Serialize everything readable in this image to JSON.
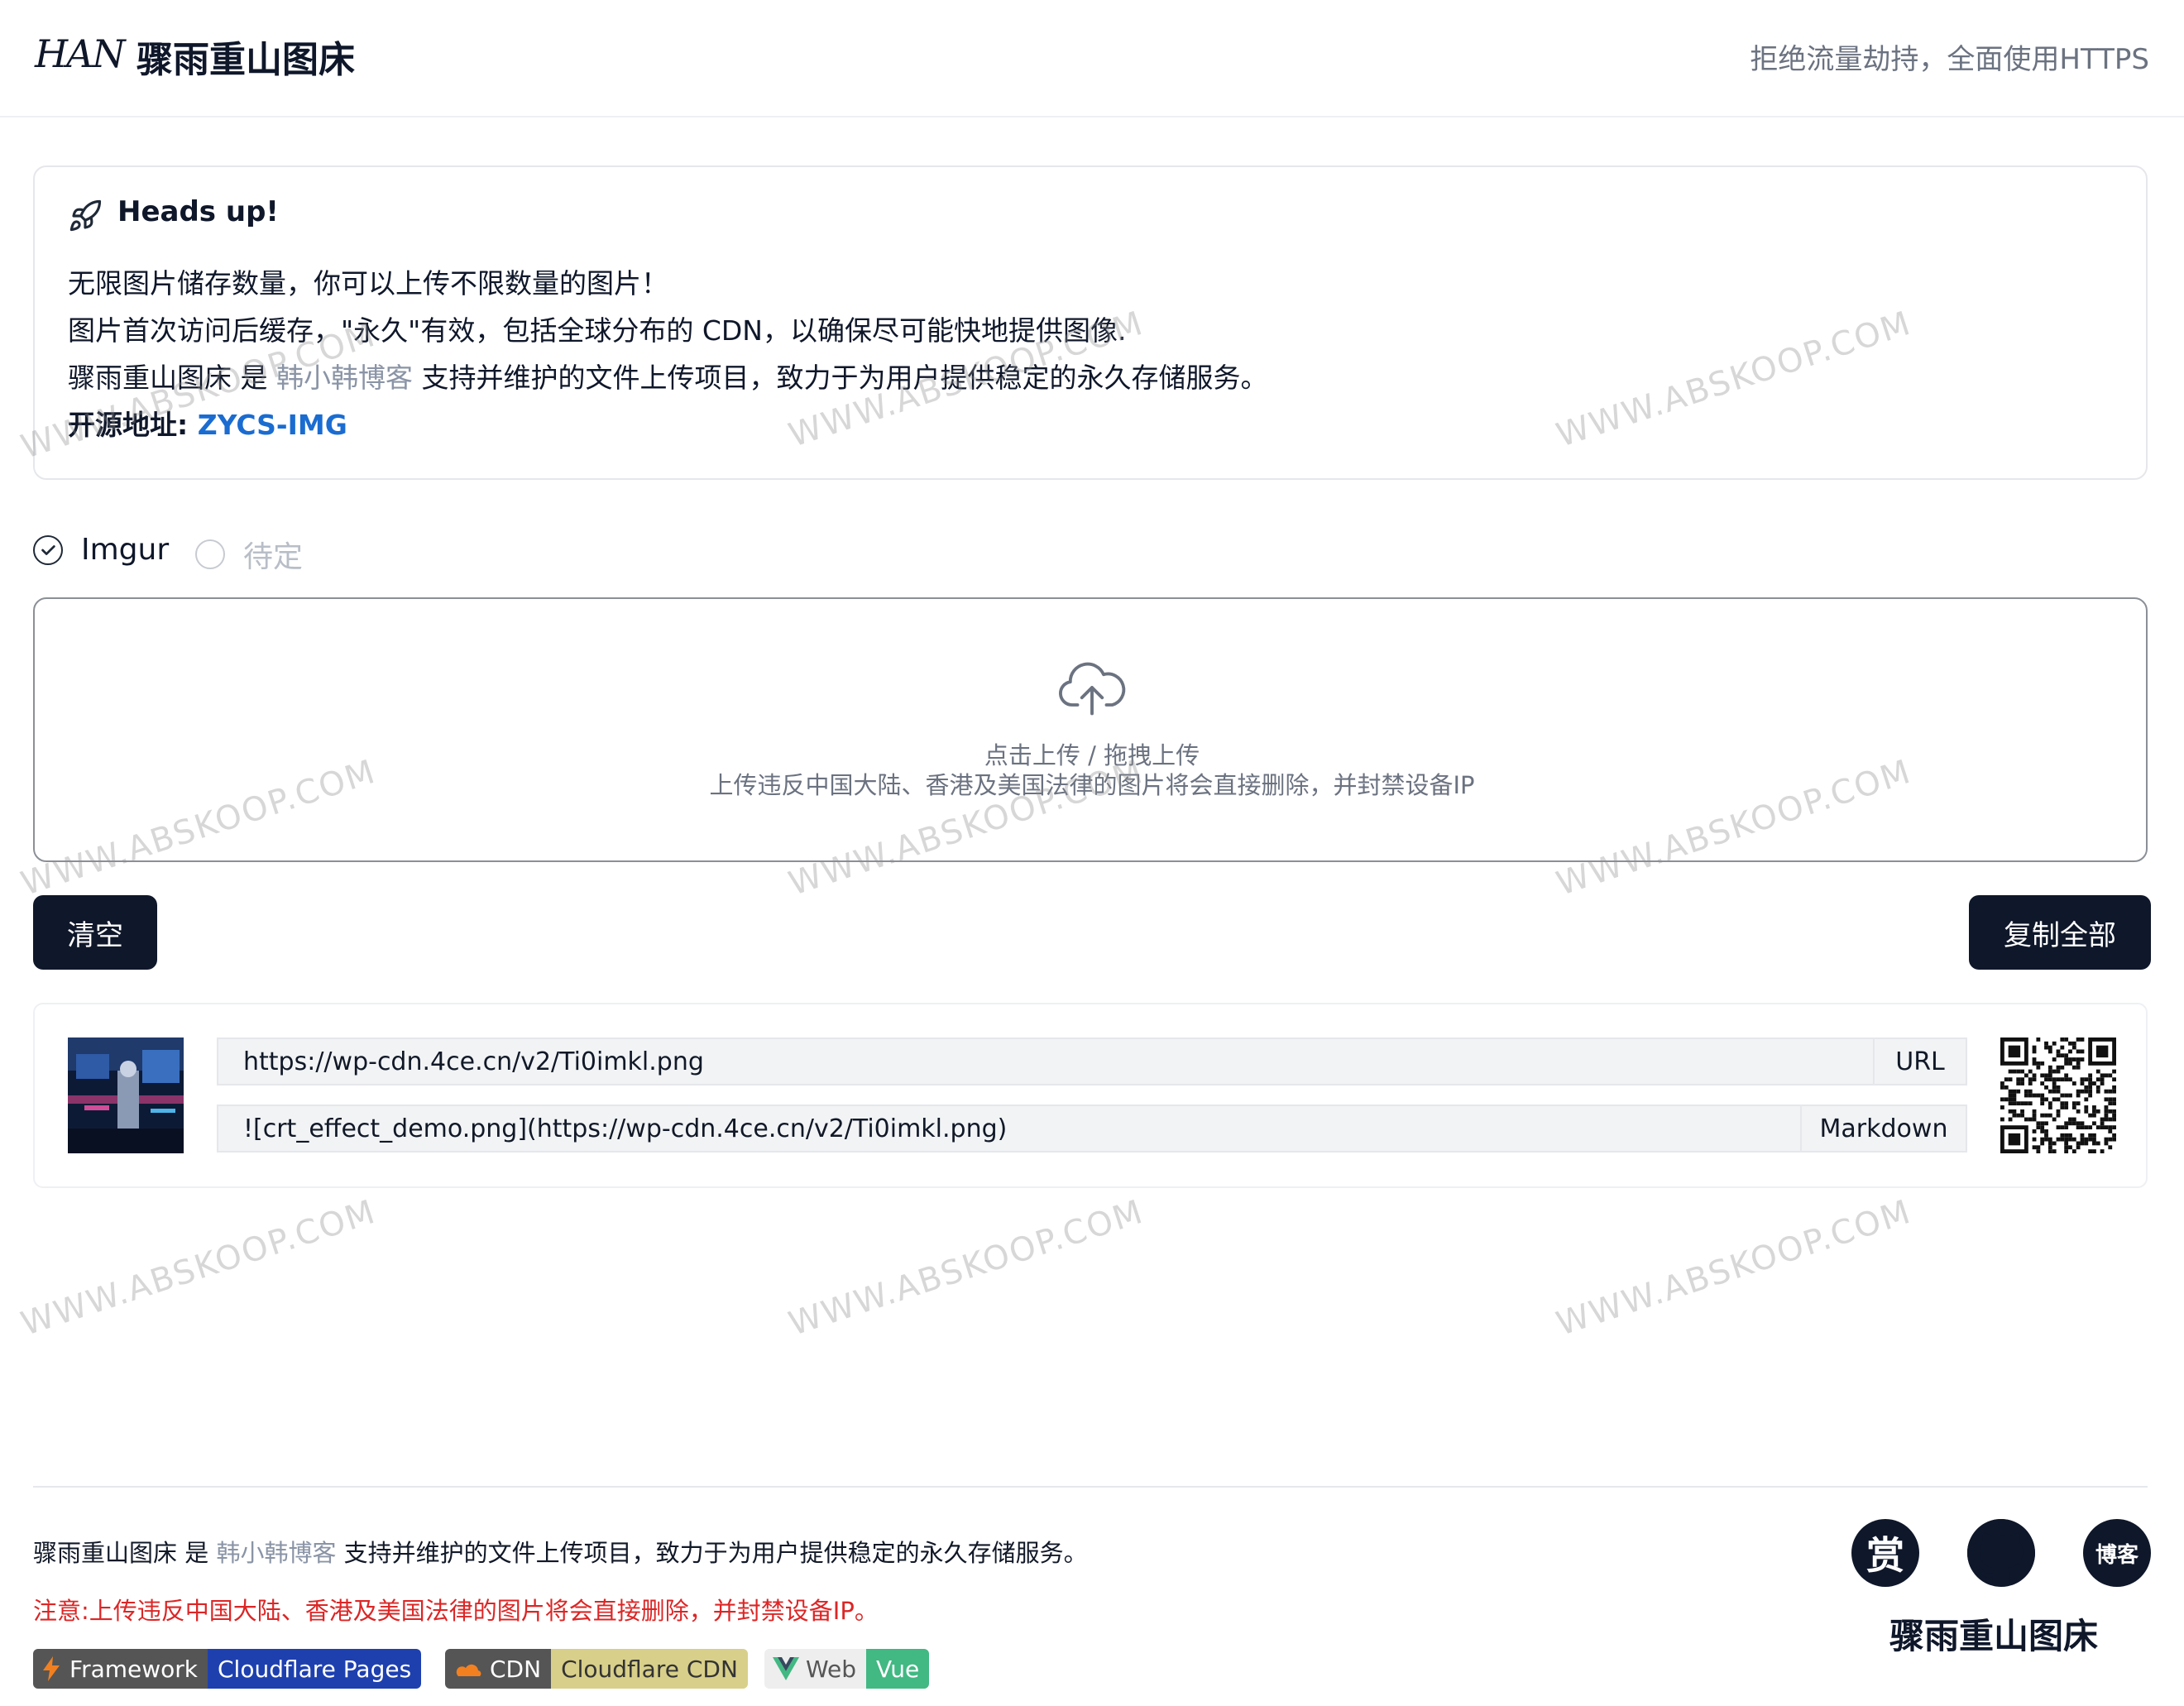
{
  "header": {
    "logo_text": "HAN",
    "title": "骤雨重山图床",
    "tagline": "拒绝流量劫持，全面使用HTTPS"
  },
  "notice": {
    "title": "Heads up!",
    "line1": "无限图片储存数量，你可以上传不限数量的图片！",
    "line2": "图片首次访问后缓存，\"永久\"有效，包括全球分布的 CDN，以确保尽可能快地提供图像.",
    "line3_prefix": "骤雨重山图床 是 ",
    "line3_link": "韩小韩博客",
    "line3_suffix": " 支持并维护的文件上传项目，致力于为用户提供稳定的永久存储服务。",
    "source_label": "开源地址: ",
    "source_link": "ZYCS-IMG"
  },
  "hosts": [
    {
      "label": "Imgur",
      "checked": true
    },
    {
      "label": "待定",
      "checked": false
    }
  ],
  "upload": {
    "primary": "点击上传 / 拖拽上传",
    "warning": "上传违反中国大陆、香港及美国法律的图片将会直接删除，并封禁设备IP"
  },
  "buttons": {
    "clear": "清空",
    "copy_all": "复制全部"
  },
  "result": {
    "url": "https://wp-cdn.4ce.cn/v2/Ti0imkl.png",
    "url_label": "URL",
    "markdown": "![crt_effect_demo.png](https://wp-cdn.4ce.cn/v2/Ti0imkl.png)",
    "markdown_label": "Markdown"
  },
  "footer": {
    "prefix": "骤雨重山图床 是 ",
    "link": "韩小韩博客",
    "suffix": " 支持并维护的文件上传项目，致力于为用户提供稳定的永久存储服务。",
    "warning": "注意:上传违反中国大陆、香港及美国法律的图片将会直接删除，并封禁设备IP。",
    "reward_label": "赏",
    "blog_label": "博客",
    "brand": "骤雨重山图床",
    "badges": [
      {
        "key": "Framework",
        "value": "Cloudflare Pages",
        "value_color": "#1e40af"
      },
      {
        "key": "CDN",
        "value": "Cloudflare CDN",
        "value_color": "#d8cf8a"
      },
      {
        "key": "Web",
        "value": "Vue",
        "value_color": "#42b883"
      }
    ]
  },
  "watermark": "WWW.ABSKOOP.COM"
}
